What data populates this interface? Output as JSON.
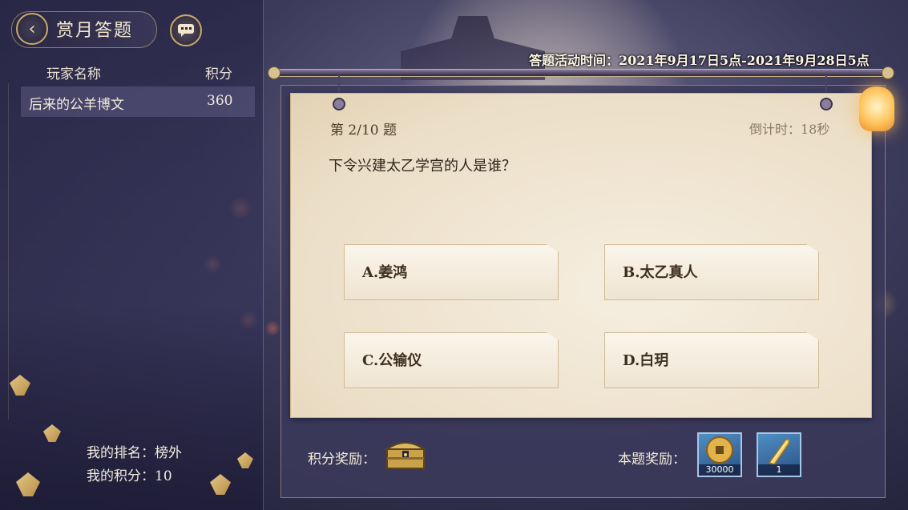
{
  "header": {
    "title": "赏月答题",
    "event_time": "答题活动时间：2021年9月17日5点-2021年9月28日5点"
  },
  "leaderboard": {
    "col_name": "玩家名称",
    "col_score": "积分",
    "rows": [
      {
        "name": "后来的公羊博文",
        "score": "360"
      }
    ]
  },
  "my_stats": {
    "rank": "我的排名：榜外",
    "score": "我的积分：10"
  },
  "question": {
    "number": "第 2/10 题",
    "countdown": "倒计时：18秒",
    "text": "下令兴建太乙学宫的人是谁？",
    "options": [
      {
        "label": "A.姜鸿"
      },
      {
        "label": "B.太乙真人"
      },
      {
        "label": "C.公输仪"
      },
      {
        "label": "D.白玥"
      }
    ]
  },
  "rewards": {
    "score_reward_label": "积分奖励：",
    "question_reward_label": "本题奖励：",
    "items": [
      {
        "icon": "copper-coin-icon",
        "count": "30000"
      },
      {
        "icon": "golden-feather-icon",
        "count": "1"
      }
    ]
  }
}
